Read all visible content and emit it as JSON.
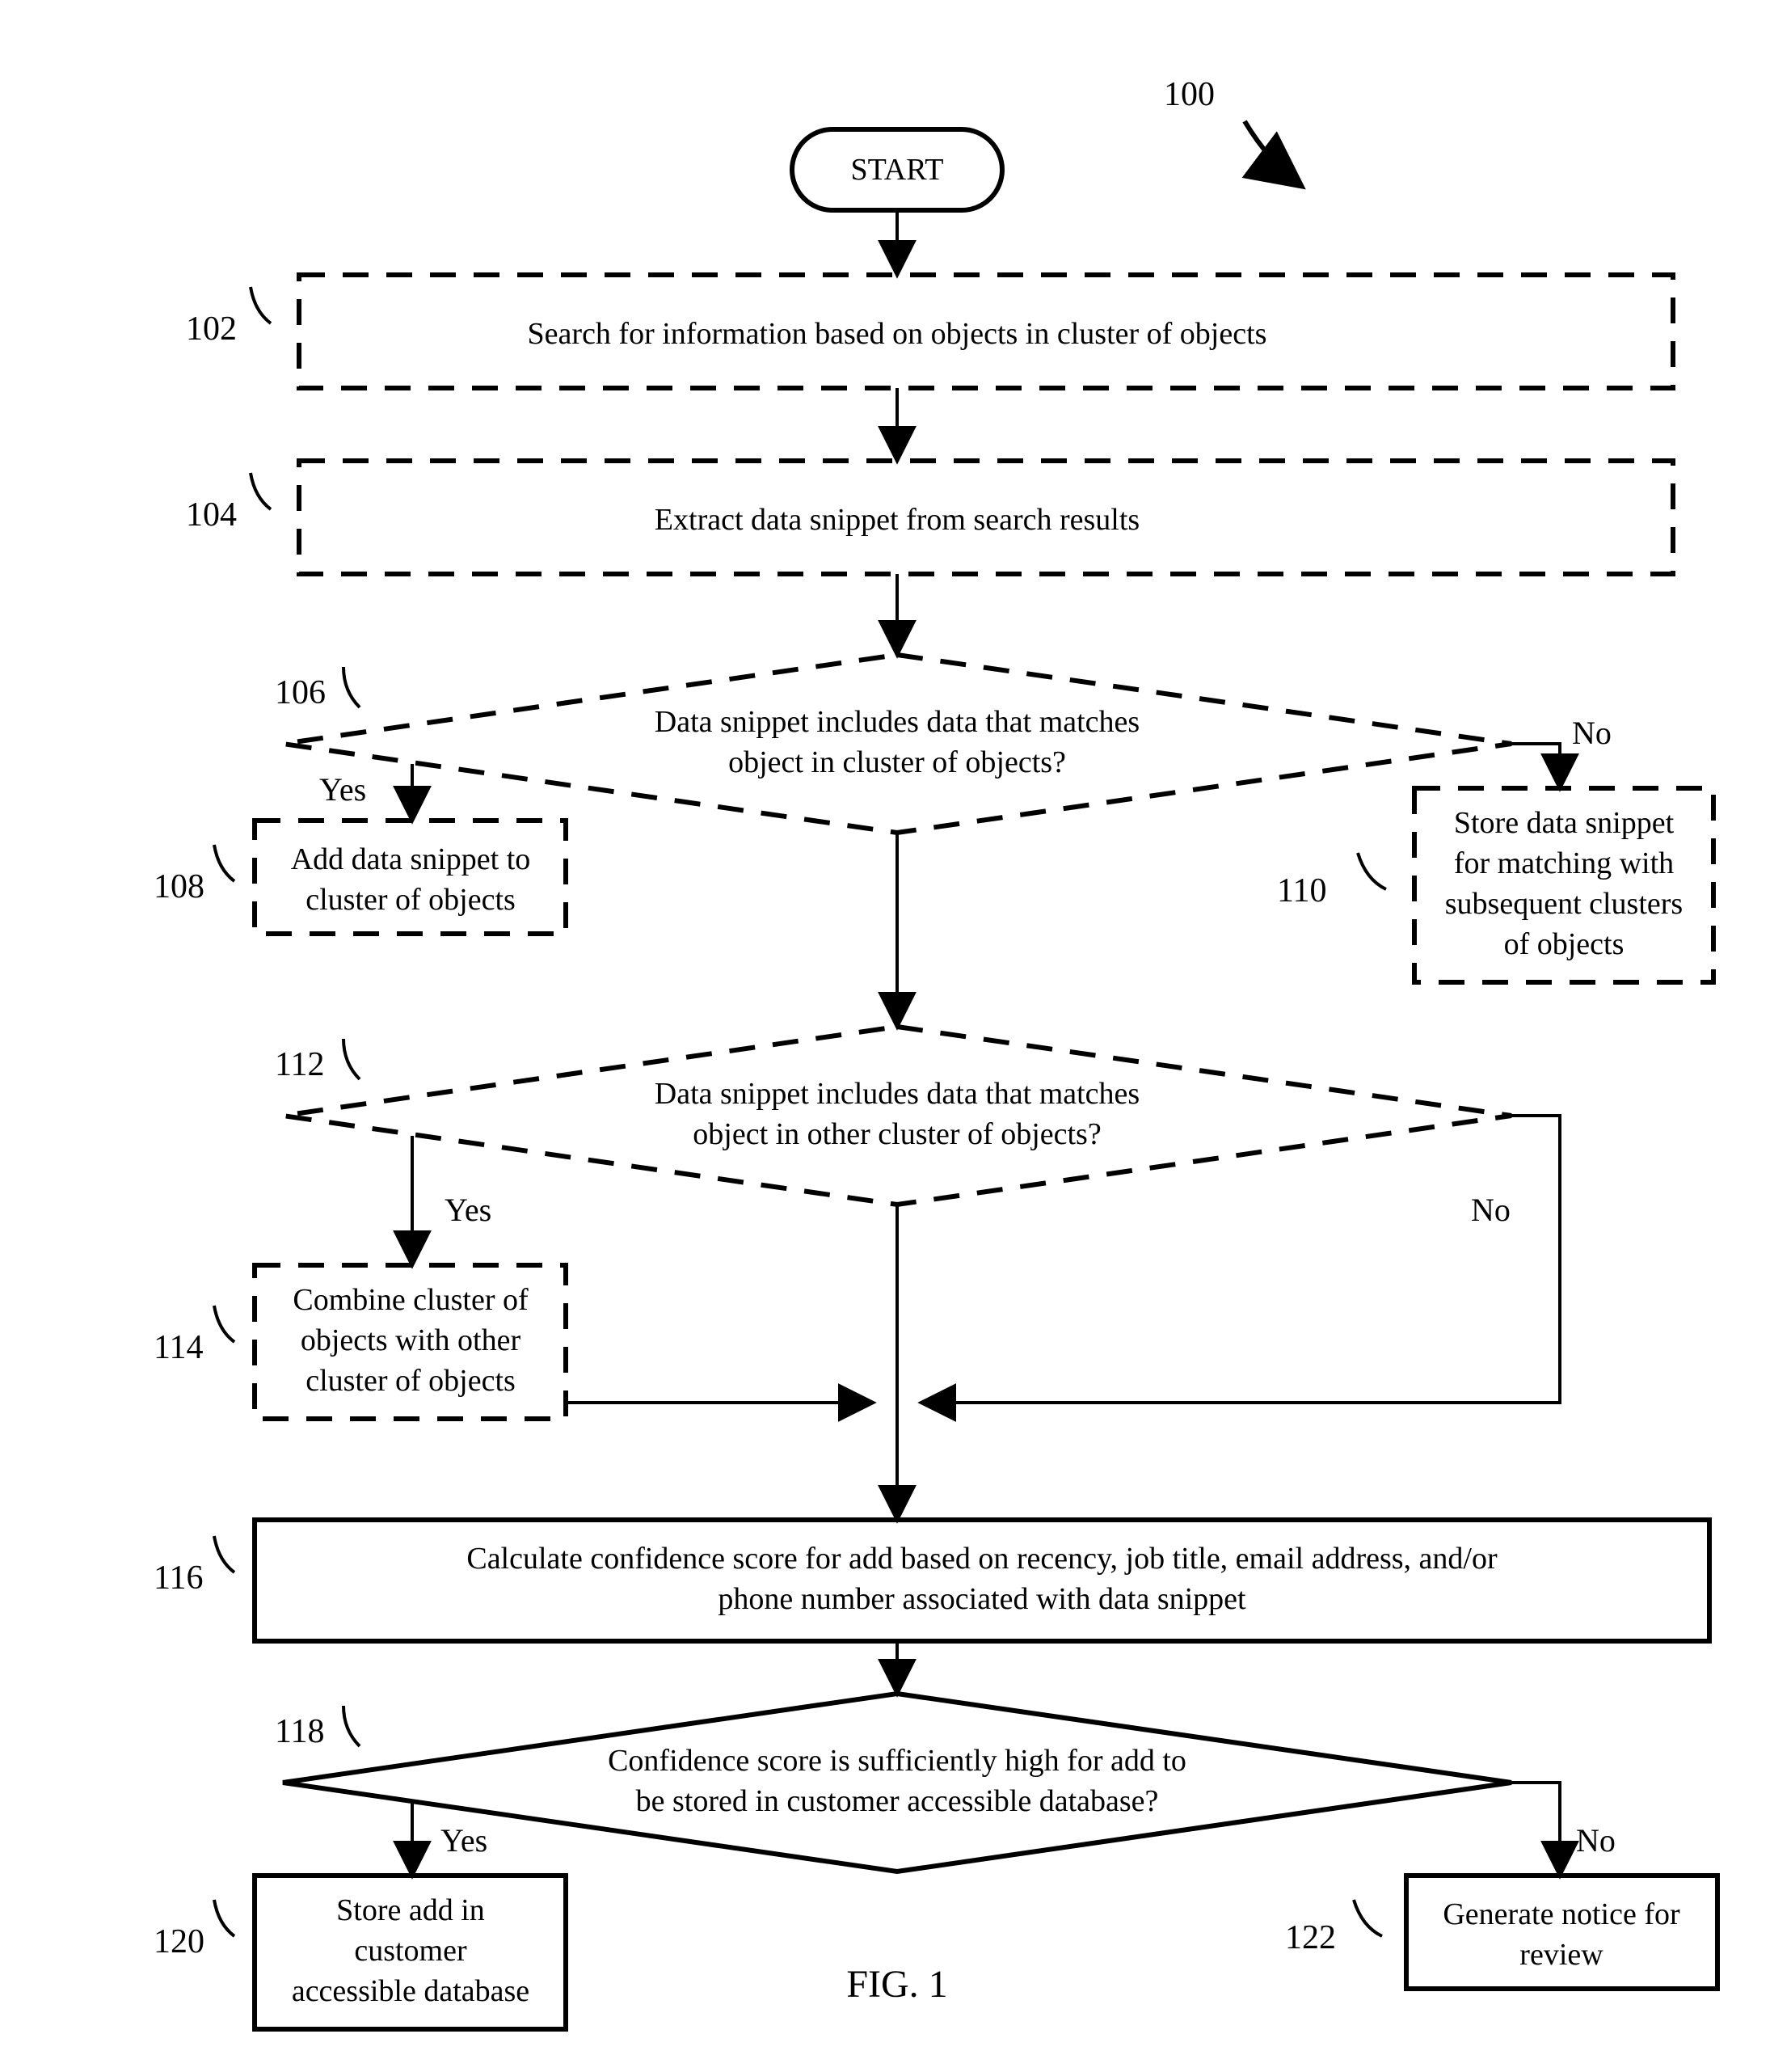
{
  "figure": {
    "label": "FIG. 1",
    "ref": "100"
  },
  "start": {
    "label": "START"
  },
  "steps": {
    "s102": {
      "ref": "102",
      "line1": "Search for information based on objects in cluster of objects"
    },
    "s104": {
      "ref": "104",
      "line1": "Extract data snippet from search results"
    },
    "s106": {
      "ref": "106",
      "line1": "Data snippet includes data that matches",
      "line2": "object in cluster of objects?"
    },
    "s108": {
      "ref": "108",
      "line1": "Add data snippet to",
      "line2": "cluster of objects"
    },
    "s110": {
      "ref": "110",
      "line1": "Store data snippet",
      "line2": "for matching with",
      "line3": "subsequent clusters",
      "line4": "of objects"
    },
    "s112": {
      "ref": "112",
      "line1": "Data snippet includes data that matches",
      "line2": "object in other cluster of objects?"
    },
    "s114": {
      "ref": "114",
      "line1": "Combine cluster of",
      "line2": "objects with other",
      "line3": "cluster of objects"
    },
    "s116": {
      "ref": "116",
      "line1": "Calculate confidence score for add based on  recency, job title, email address, and/or",
      "line2": "phone number associated with data snippet"
    },
    "s118": {
      "ref": "118",
      "line1": "Confidence score is sufficiently high for add to",
      "line2": "be stored in customer accessible database?"
    },
    "s120": {
      "ref": "120",
      "line1": "Store add in",
      "line2": "customer",
      "line3": "accessible database"
    },
    "s122": {
      "ref": "122",
      "line1": "Generate notice for",
      "line2": "review"
    }
  },
  "labels": {
    "yes": "Yes",
    "no": "No"
  }
}
